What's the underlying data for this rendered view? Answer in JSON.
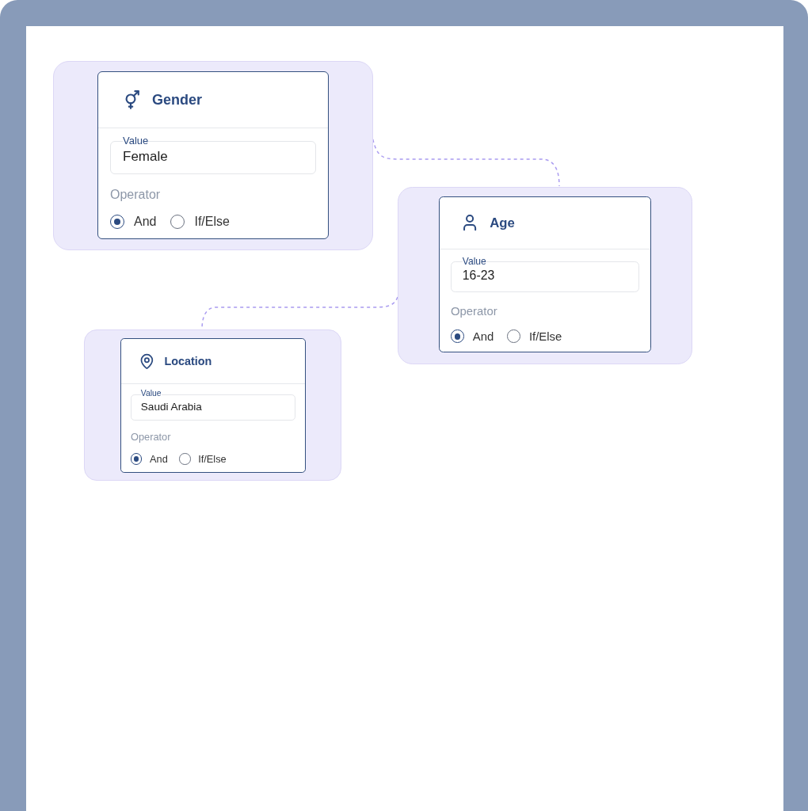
{
  "nodes": [
    {
      "title": "Gender",
      "value_label": "Value",
      "value": "Female",
      "operator_label": "Operator",
      "options": [
        {
          "label": "And",
          "selected": true
        },
        {
          "label": "If/Else",
          "selected": false
        }
      ]
    },
    {
      "title": "Age",
      "value_label": "Value",
      "value": "16-23",
      "operator_label": "Operator",
      "options": [
        {
          "label": "And",
          "selected": true
        },
        {
          "label": "If/Else",
          "selected": false
        }
      ]
    },
    {
      "title": "Location",
      "value_label": "Value",
      "value": "Saudi Arabia",
      "operator_label": "Operator",
      "options": [
        {
          "label": "And",
          "selected": true
        },
        {
          "label": "If/Else",
          "selected": false
        }
      ]
    }
  ]
}
